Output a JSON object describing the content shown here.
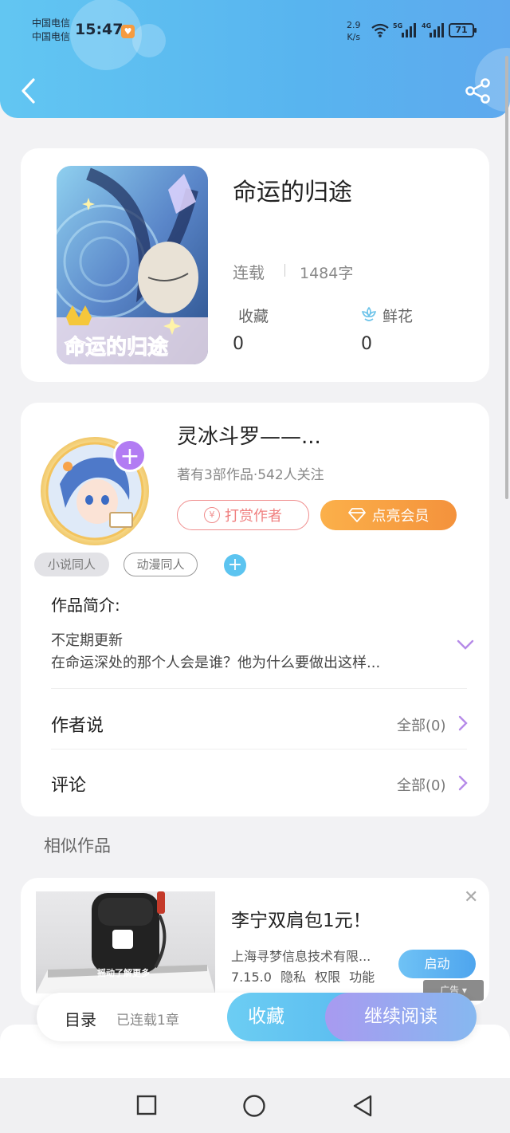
{
  "status_bar": {
    "carrier_1": "中国电信",
    "carrier_2": "中国电信",
    "time": "15:47",
    "net_speed_value": "2.9",
    "net_speed_unit": "K/s",
    "sig1_label": "5G",
    "sig2_label": "4G",
    "battery": "71"
  },
  "book": {
    "title": "命运的归途",
    "status": "连载",
    "word_count": "1484字",
    "collect_label": "收藏",
    "collect_count": "0",
    "flower_label": "鲜花",
    "flower_count": "0"
  },
  "author": {
    "name": "灵冰斗罗——...",
    "meta": "著有3部作品·542人关注",
    "tip_label": "打赏作者",
    "tip_coin": "¥",
    "vip_label": "点亮会员"
  },
  "tags": [
    "小说同人",
    "动漫同人"
  ],
  "intro": {
    "label": "作品简介:",
    "line1": "不定期更新",
    "line2": "在命运深处的那个人会是谁？他为什么要做出这样..."
  },
  "rows": {
    "author_says": "作者说",
    "author_says_right": "全部(0)",
    "comments": "评论",
    "comments_right": "全部(0)"
  },
  "similar_title": "相似作品",
  "ad": {
    "title": "李宁双肩包1元！",
    "company": "上海寻梦信息技术有限...",
    "meta": "7.15.0 隐私 权限 功能",
    "start_label": "启动",
    "badge": "广告",
    "image_caption": "摇动了解更多"
  },
  "action_bar": {
    "toc_label": "目录",
    "toc_count": "已连载1章",
    "fav_label": "收藏",
    "read_label": "继续阅读"
  },
  "colors": {
    "header_blue": "#58b4ef",
    "accent_purple": "#b27cf3",
    "tip_red": "#f07f7f",
    "vip_orange": "#f4923c"
  }
}
